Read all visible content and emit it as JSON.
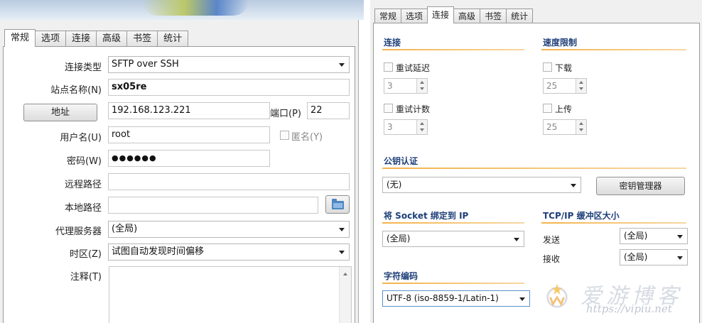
{
  "left": {
    "tabs": [
      {
        "label": "常规",
        "active": true
      },
      {
        "label": "选项"
      },
      {
        "label": "连接"
      },
      {
        "label": "高级"
      },
      {
        "label": "书签"
      },
      {
        "label": "统计"
      }
    ],
    "labels": {
      "conn_type": "连接类型",
      "site_name": "站点名称(N)",
      "address_btn": "地址",
      "port": "端口(P)",
      "username": "用户名(U)",
      "anonymous": "匿名(Y)",
      "password": "密码(W)",
      "remote_path": "远程路径",
      "local_path": "本地路径",
      "proxy": "代理服务器",
      "timezone": "时区(Z)",
      "notes": "注释(T)"
    },
    "values": {
      "conn_type": "SFTP over SSH",
      "site_name": "sx05re",
      "address": "192.168.123.221",
      "port": "22",
      "username": "root",
      "password": "●●●●●●",
      "remote_path": "",
      "local_path": "",
      "proxy": "(全局)",
      "timezone": "试图自动发现时间偏移",
      "notes": ""
    }
  },
  "right": {
    "tabs": [
      {
        "label": "常规"
      },
      {
        "label": "选项"
      },
      {
        "label": "连接",
        "active": true
      },
      {
        "label": "高级"
      },
      {
        "label": "书签"
      },
      {
        "label": "统计"
      }
    ],
    "sections": {
      "connection": "连接",
      "speed_limit": "速度限制",
      "pubkey": "公钥认证",
      "bind_socket": "将 Socket 绑定到 IP",
      "tcp_buffer": "TCP/IP 缓冲区大小",
      "charset": "字符编码"
    },
    "connection": {
      "retry_delay_label": "重试延迟",
      "retry_delay_value": "3",
      "retry_count_label": "重试计数",
      "retry_count_value": "3"
    },
    "speed": {
      "download_label": "下载",
      "download_value": "25",
      "upload_label": "上传",
      "upload_value": "25"
    },
    "pubkey": {
      "value": "(无)",
      "key_manager_btn": "密钥管理器"
    },
    "bind": {
      "value": "(全局)"
    },
    "tcp": {
      "send_label": "发送",
      "send_value": "(全局)",
      "recv_label": "接收",
      "recv_value": "(全局)"
    },
    "charset": {
      "value": "UTF-8 (iso-8859-1/Latin-1)"
    }
  },
  "watermark": {
    "title": "爱游博客",
    "url": "https://vipiu.net"
  },
  "colors": {
    "section_title": "#1e3f78",
    "section_line": "#f4b34a",
    "folder_icon": "#4f86c2"
  }
}
